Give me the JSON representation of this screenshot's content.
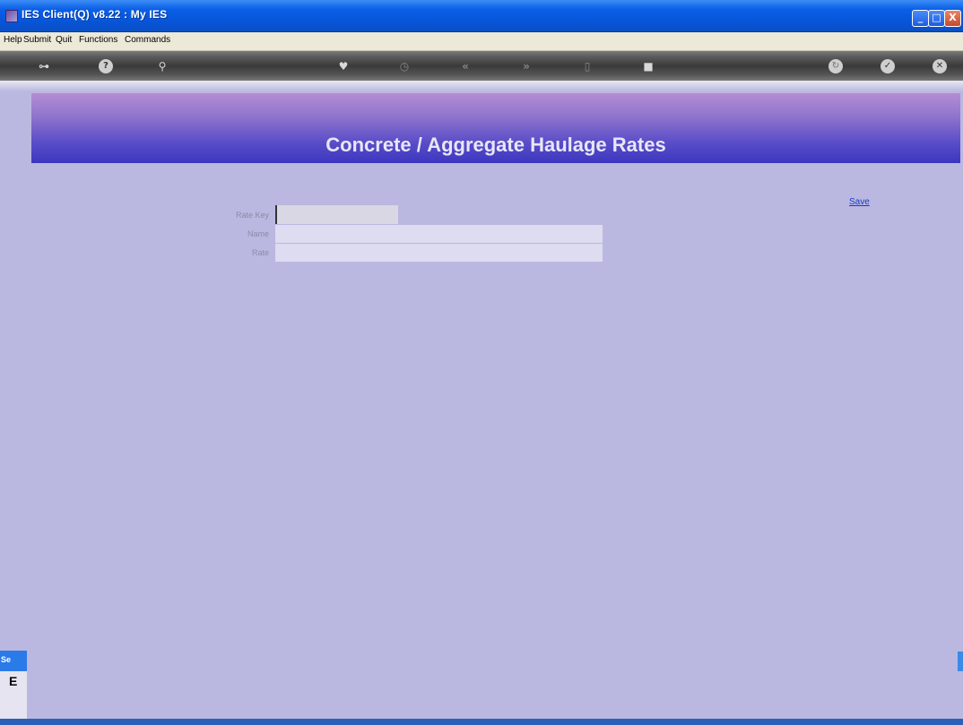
{
  "window": {
    "title": "IES Client(Q) v8.22 : My IES",
    "controls": {
      "minimize": "_",
      "maximize": "□",
      "close": "X"
    }
  },
  "menu": {
    "items": [
      "Help",
      "Submit",
      "Quit",
      "Functions",
      "Commands"
    ]
  },
  "toolbar": {
    "icons": [
      {
        "name": "key-icon",
        "glyph": "⊶"
      },
      {
        "name": "help-icon",
        "glyph": "?"
      },
      {
        "name": "search-icon",
        "glyph": "⚲"
      },
      {
        "name": "heart-icon",
        "glyph": "♥"
      },
      {
        "name": "clock-icon",
        "glyph": "◷"
      },
      {
        "name": "rewind-icon",
        "glyph": "«"
      },
      {
        "name": "forward-icon",
        "glyph": "»"
      },
      {
        "name": "bookmark-icon",
        "glyph": "▯"
      },
      {
        "name": "stop-icon",
        "glyph": "■"
      },
      {
        "name": "refresh-icon",
        "glyph": "↻"
      },
      {
        "name": "check-icon",
        "glyph": "✓"
      },
      {
        "name": "close-icon",
        "glyph": "✕"
      }
    ]
  },
  "page": {
    "title": "Concrete / Aggregate Haulage Rates"
  },
  "form": {
    "rate_key": {
      "label": "Rate Key",
      "value": ""
    },
    "name": {
      "label": "Name",
      "value": ""
    },
    "rate": {
      "label": "Rate",
      "value": ""
    },
    "save_label": "Save"
  },
  "status": {
    "label": "Se",
    "value": "E"
  }
}
